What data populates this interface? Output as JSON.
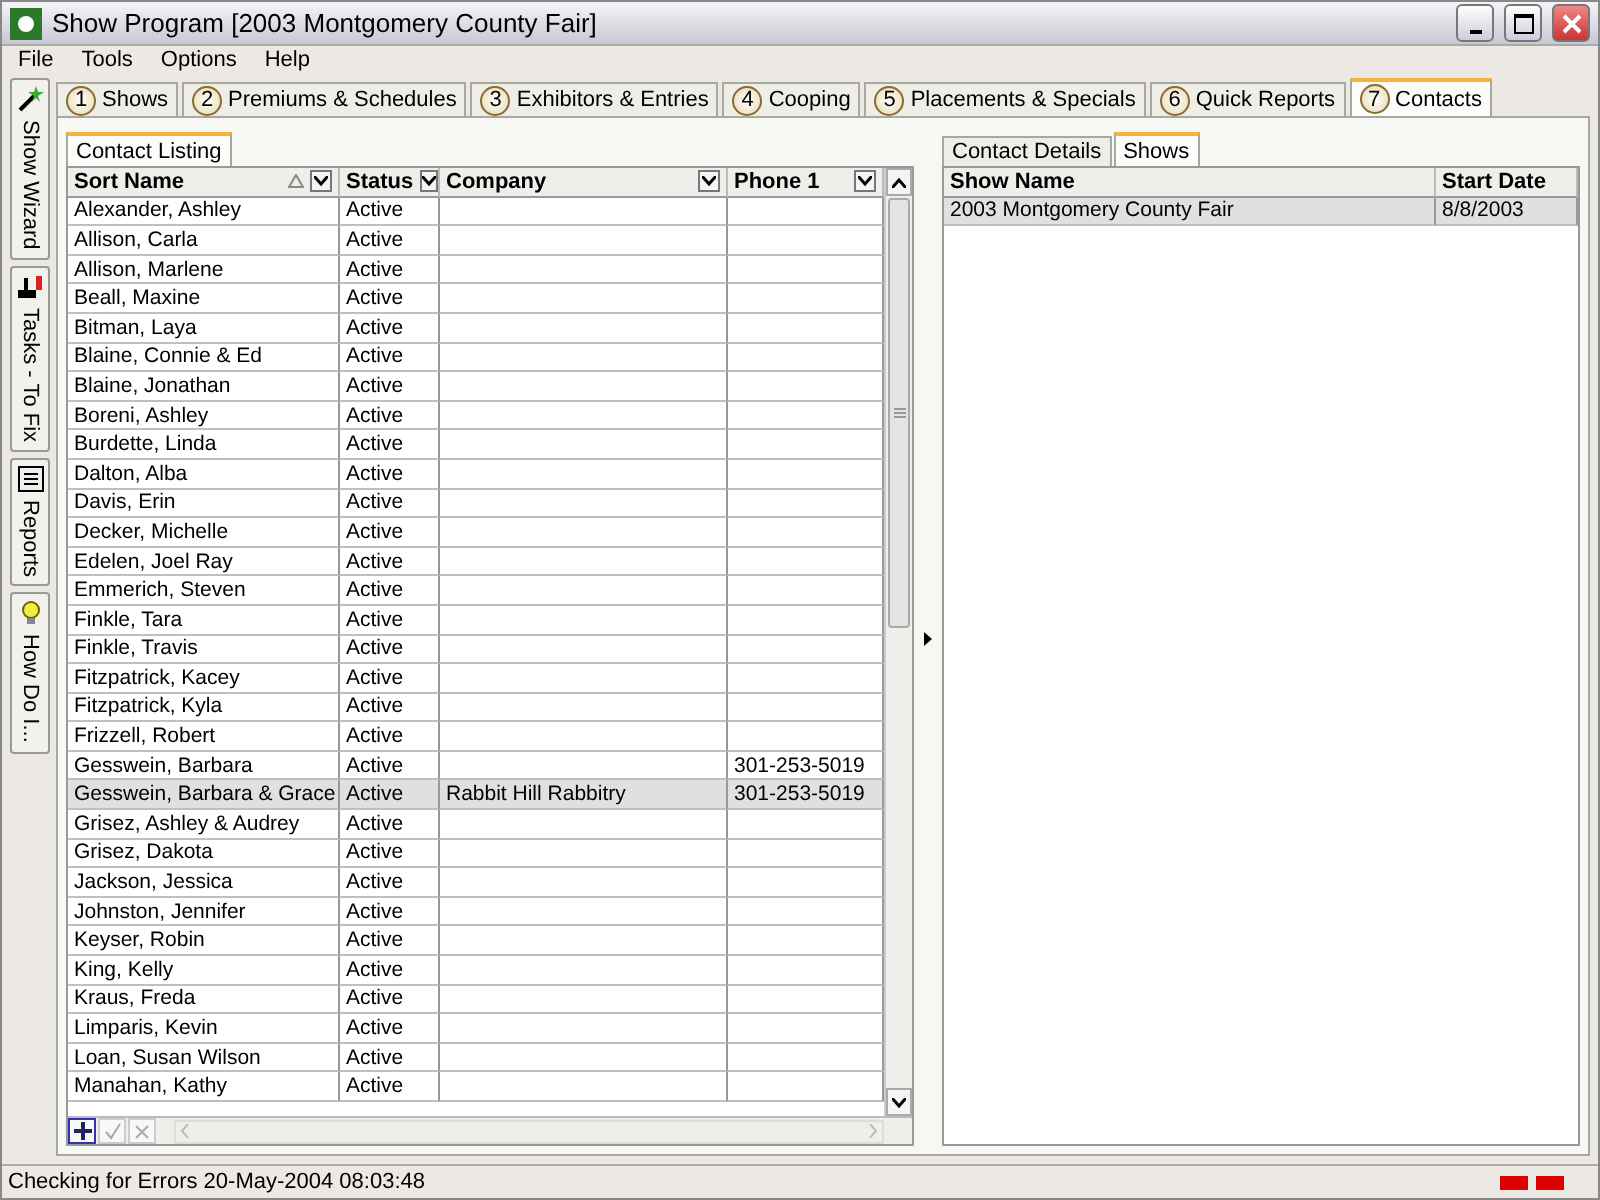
{
  "window": {
    "title": "Show Program [2003 Montgomery County Fair]"
  },
  "menu": [
    "File",
    "Tools",
    "Options",
    "Help"
  ],
  "side_tabs": [
    {
      "label": "Show Wizard",
      "kind": "wand"
    },
    {
      "label": "Tasks - To Fix",
      "kind": "tasks"
    },
    {
      "label": "Reports",
      "kind": "list"
    },
    {
      "label": "How Do I...",
      "kind": "bulb"
    }
  ],
  "tabs": [
    {
      "number": "1",
      "label": "Shows",
      "selected": false
    },
    {
      "number": "2",
      "label": "Premiums & Schedules",
      "selected": false
    },
    {
      "number": "3",
      "label": "Exhibitors & Entries",
      "selected": false
    },
    {
      "number": "4",
      "label": "Cooping",
      "selected": false
    },
    {
      "number": "5",
      "label": "Placements & Specials",
      "selected": false
    },
    {
      "number": "6",
      "label": "Quick Reports",
      "selected": false
    },
    {
      "number": "7",
      "label": "Contacts",
      "selected": true
    }
  ],
  "listing": {
    "tab": "Contact Listing",
    "columns": [
      {
        "label": "Sort Name",
        "sorted": true
      },
      {
        "label": "Status",
        "sorted": false
      },
      {
        "label": "Company",
        "sorted": false
      },
      {
        "label": "Phone 1",
        "sorted": false
      }
    ],
    "rows": [
      {
        "cells": [
          "Alexander, Ashley",
          "Active",
          "",
          ""
        ],
        "selected": false
      },
      {
        "cells": [
          "Allison, Carla",
          "Active",
          "",
          ""
        ],
        "selected": false
      },
      {
        "cells": [
          "Allison, Marlene",
          "Active",
          "",
          ""
        ],
        "selected": false
      },
      {
        "cells": [
          "Beall, Maxine",
          "Active",
          "",
          ""
        ],
        "selected": false
      },
      {
        "cells": [
          "Bitman, Laya",
          "Active",
          "",
          ""
        ],
        "selected": false
      },
      {
        "cells": [
          "Blaine, Connie & Ed",
          "Active",
          "",
          ""
        ],
        "selected": false
      },
      {
        "cells": [
          "Blaine, Jonathan",
          "Active",
          "",
          ""
        ],
        "selected": false
      },
      {
        "cells": [
          "Boreni, Ashley",
          "Active",
          "",
          ""
        ],
        "selected": false
      },
      {
        "cells": [
          "Burdette, Linda",
          "Active",
          "",
          ""
        ],
        "selected": false
      },
      {
        "cells": [
          "Dalton, Alba",
          "Active",
          "",
          ""
        ],
        "selected": false
      },
      {
        "cells": [
          "Davis, Erin",
          "Active",
          "",
          ""
        ],
        "selected": false
      },
      {
        "cells": [
          "Decker, Michelle",
          "Active",
          "",
          ""
        ],
        "selected": false
      },
      {
        "cells": [
          "Edelen, Joel Ray",
          "Active",
          "",
          ""
        ],
        "selected": false
      },
      {
        "cells": [
          "Emmerich, Steven",
          "Active",
          "",
          ""
        ],
        "selected": false
      },
      {
        "cells": [
          "Finkle, Tara",
          "Active",
          "",
          ""
        ],
        "selected": false
      },
      {
        "cells": [
          "Finkle, Travis",
          "Active",
          "",
          ""
        ],
        "selected": false
      },
      {
        "cells": [
          "Fitzpatrick, Kacey",
          "Active",
          "",
          ""
        ],
        "selected": false
      },
      {
        "cells": [
          "Fitzpatrick, Kyla",
          "Active",
          "",
          ""
        ],
        "selected": false
      },
      {
        "cells": [
          "Frizzell, Robert",
          "Active",
          "",
          ""
        ],
        "selected": false
      },
      {
        "cells": [
          "Gesswein, Barbara",
          "Active",
          "",
          "301-253-5019"
        ],
        "selected": false
      },
      {
        "cells": [
          "Gesswein, Barbara & Grace",
          "Active",
          "Rabbit Hill Rabbitry",
          "301-253-5019"
        ],
        "selected": true
      },
      {
        "cells": [
          "Grisez, Ashley & Audrey",
          "Active",
          "",
          ""
        ],
        "selected": false
      },
      {
        "cells": [
          "Grisez, Dakota",
          "Active",
          "",
          ""
        ],
        "selected": false
      },
      {
        "cells": [
          "Jackson, Jessica",
          "Active",
          "",
          ""
        ],
        "selected": false
      },
      {
        "cells": [
          "Johnston, Jennifer",
          "Active",
          "",
          ""
        ],
        "selected": false
      },
      {
        "cells": [
          "Keyser, Robin",
          "Active",
          "",
          ""
        ],
        "selected": false
      },
      {
        "cells": [
          "King, Kelly",
          "Active",
          "",
          ""
        ],
        "selected": false
      },
      {
        "cells": [
          "Kraus, Freda",
          "Active",
          "",
          ""
        ],
        "selected": false
      },
      {
        "cells": [
          "Limparis, Kevin",
          "Active",
          "",
          ""
        ],
        "selected": false
      },
      {
        "cells": [
          "Loan, Susan Wilson",
          "Active",
          "",
          ""
        ],
        "selected": false
      },
      {
        "cells": [
          "Manahan, Kathy",
          "Active",
          "",
          ""
        ],
        "selected": false
      }
    ]
  },
  "detail": {
    "tabs": [
      {
        "label": "Contact Details",
        "selected": false
      },
      {
        "label": "Shows",
        "selected": true
      }
    ],
    "columns": [
      "Show Name",
      "Start Date"
    ],
    "rows": [
      {
        "cells": [
          "2003 Montgomery County Fair",
          "8/8/2003"
        ],
        "selected": true
      }
    ]
  },
  "status_bar": {
    "text": "Checking for Errors 20-May-2004 08:03:48"
  }
}
